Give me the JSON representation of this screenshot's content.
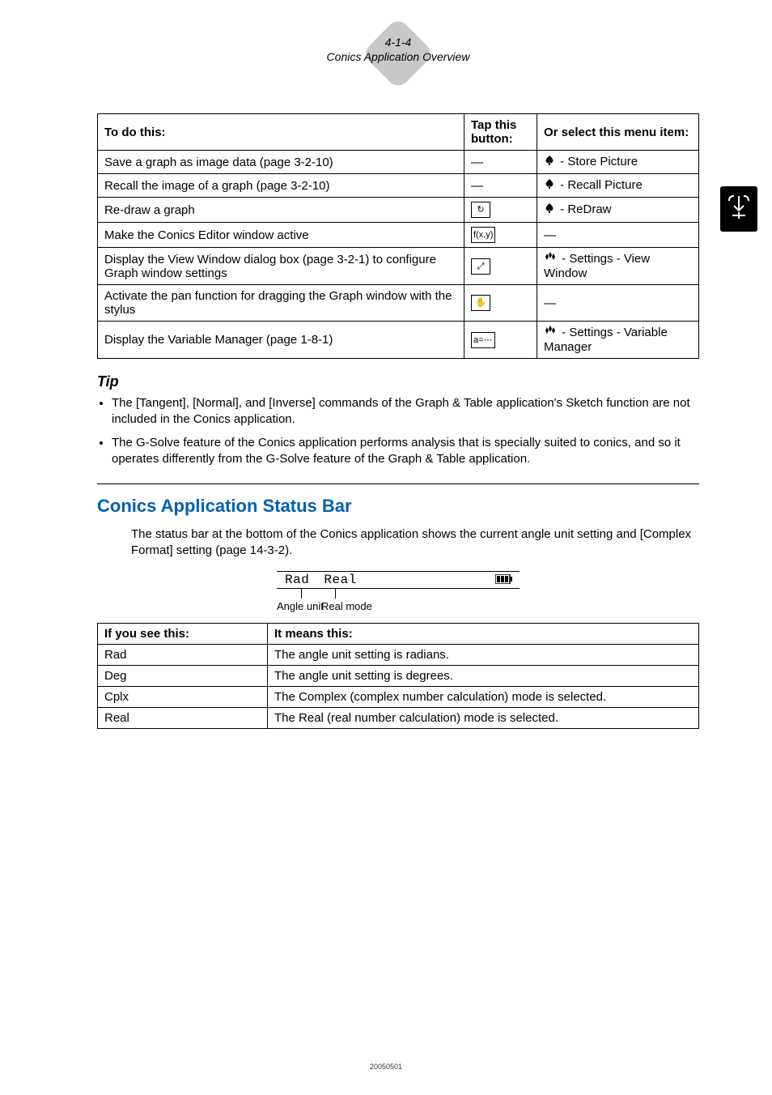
{
  "header": {
    "page_num": "4-1-4",
    "section_title": "Conics Application Overview"
  },
  "table1": {
    "headers": {
      "col1": "To do this:",
      "col2": "Tap this button:",
      "col3": "Or select this menu item:"
    },
    "rows": [
      {
        "action": "Save a graph as image data (page 3-2-10)",
        "button": "—",
        "button_is_icon": false,
        "menu": " - Store Picture",
        "menu_marker": "spade"
      },
      {
        "action": "Recall the image of a graph (page 3-2-10)",
        "button": "—",
        "button_is_icon": false,
        "menu": " - Recall Picture",
        "menu_marker": "spade"
      },
      {
        "action": "Re-draw a graph",
        "button": "↻",
        "button_is_icon": true,
        "menu": " - ReDraw",
        "menu_marker": "spade"
      },
      {
        "action": "Make the Conics Editor window active",
        "button": "f(x,y)",
        "button_is_icon": true,
        "menu": "—",
        "menu_marker": ""
      },
      {
        "action": "Display the View Window dialog box (page 3-2-1) to configure Graph window settings",
        "button": "⤢",
        "button_is_icon": true,
        "menu": " - Settings - View Window",
        "menu_marker": "clover"
      },
      {
        "action": "Activate the pan function for dragging the Graph window with the stylus",
        "button": "✋",
        "button_is_icon": true,
        "menu": "—",
        "menu_marker": ""
      },
      {
        "action": "Display the Variable Manager (page 1-8-1)",
        "button": "a=⋯",
        "button_is_icon": true,
        "menu": " - Settings - Variable Manager",
        "menu_marker": "clover"
      }
    ]
  },
  "tip": {
    "heading": "Tip",
    "items": [
      "The [Tangent], [Normal], and [Inverse] commands of the Graph & Table application's Sketch function are not included in the Conics application.",
      "The G-Solve feature of the Conics application performs analysis that is specially suited to conics, and so it operates differently from the G-Solve feature of the Graph & Table application."
    ]
  },
  "section2": {
    "heading": "Conics Application Status Bar",
    "paragraph": "The status bar at the bottom of the Conics application shows the current angle unit setting and [Complex Format] setting (page 14-3-2).",
    "status_bar": {
      "label1": "Rad",
      "label2": "Real"
    },
    "leaders": {
      "l1": "Angle unit",
      "l2": "Real mode"
    }
  },
  "table2": {
    "headers": {
      "col1": "If you see this:",
      "col2": "It means this:"
    },
    "rows": [
      {
        "c1": "Rad",
        "c2": "The angle unit setting is radians."
      },
      {
        "c1": "Deg",
        "c2": "The angle unit setting is degrees."
      },
      {
        "c1": "Cplx",
        "c2": "The Complex (complex number calculation) mode is selected."
      },
      {
        "c1": "Real",
        "c2": "The Real (real number calculation) mode is selected."
      }
    ]
  },
  "footer": {
    "stamp": "20050501"
  }
}
